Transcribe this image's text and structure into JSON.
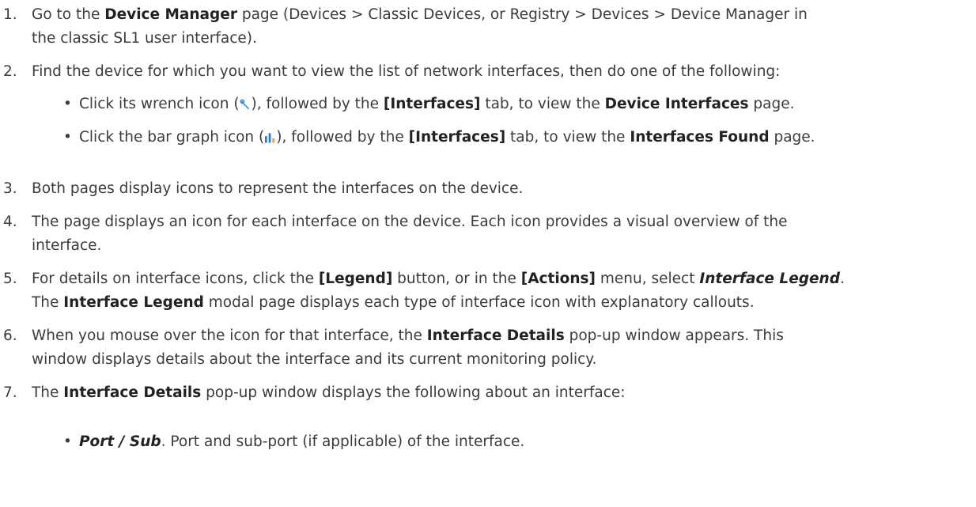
{
  "steps": [
    {
      "num": "1.",
      "pre": "Go to the ",
      "bold1": "Device Manager",
      "mid1": " page (Devices > Classic Devices, or Registry > Devices > Device Manager in",
      "line2": "the classic SL1 user interface)."
    },
    {
      "num": "2.",
      "text": "Find the device for which you want to view the list of network interfaces, then do one of the following:",
      "bullets": [
        {
          "a": "Click its wrench icon (",
          "icon": "wrench-icon",
          "b": "), followed by the ",
          "tab": "[Interfaces]",
          "c": " tab, to view the ",
          "page": "Device Interfaces",
          "d": " page."
        },
        {
          "a": "Click the bar graph icon (",
          "icon": "bar-graph-icon",
          "b": "), followed by the ",
          "tab": "[Interfaces]",
          "c": " tab, to view the ",
          "page": "Interfaces Found",
          "d": " page."
        }
      ]
    },
    {
      "num": "3.",
      "text": "Both pages display icons to represent the interfaces on the device."
    },
    {
      "num": "4.",
      "line1": "The page displays an icon for each interface on the device. Each icon provides a visual overview of the",
      "line2": "interface."
    },
    {
      "num": "5.",
      "a": "For details on interface icons, click the ",
      "btn": "[Legend]",
      "b": " button, or in the ",
      "menu": "[Actions]",
      "c": " menu, select ",
      "item": "Interface Legend",
      "d": ".",
      "l2a": "The ",
      "l2b": "Interface Legend",
      "l2c": " modal page displays each type of interface icon with explanatory callouts."
    },
    {
      "num": "6.",
      "a": "When you mouse over the icon for that interface, the ",
      "b": "Interface Details",
      "c": " pop-up window appears. This",
      "line2": "window displays details about the interface and its current monitoring policy."
    },
    {
      "num": "7.",
      "a": "The ",
      "b": "Interface Details",
      "c": " pop-up window displays the following about an interface:",
      "bullet": {
        "term": "Port / Sub",
        "rest": ". Port and sub-port (if applicable) of the interface."
      }
    }
  ],
  "colors": {
    "text": "#3b3b3b",
    "wrench_icon": "#3f8fd6",
    "bar_graph_icon": "#2a7fd4"
  }
}
